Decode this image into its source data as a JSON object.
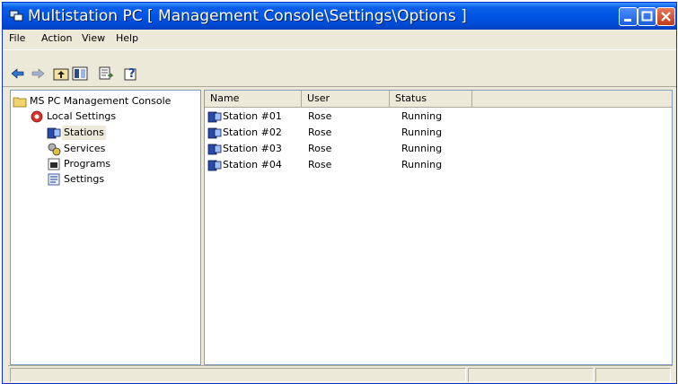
{
  "window": {
    "title": "Multistation PC [ Management Console\\Settings\\Options ]"
  },
  "menu": [
    "File",
    "Action",
    "View",
    "Help"
  ],
  "toolbar": {
    "icons": [
      "back-arrow-icon",
      "forward-arrow-icon",
      "up-folder-icon",
      "show-hide-tree-icon",
      "export-list-icon",
      "help-icon"
    ]
  },
  "tree": {
    "root": "MS PC Management Console",
    "local": "Local Settings",
    "children": [
      "Stations",
      "Services",
      "Programs",
      "Settings"
    ],
    "selected": "Stations"
  },
  "list": {
    "columns": [
      "Name",
      "User",
      "Status"
    ],
    "rows": [
      [
        "Station #01",
        "Rose",
        "Running"
      ],
      [
        "Station #02",
        "Rose",
        "Running"
      ],
      [
        "Station #03",
        "Rose",
        "Running"
      ],
      [
        "Station #04",
        "Rose",
        "Running"
      ]
    ]
  },
  "colors": {
    "titlebar": "#0055e5",
    "chrome": "#ece9d8",
    "border": "#7f9db9"
  }
}
